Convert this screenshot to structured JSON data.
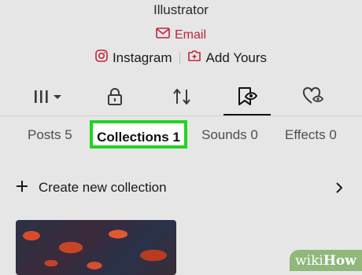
{
  "profile": {
    "bio": "Illustrator",
    "email_label": "Email",
    "links": [
      {
        "label": "Instagram",
        "icon": "instagram-icon"
      },
      {
        "label": "Add Yours",
        "icon": "add-yours-icon"
      }
    ]
  },
  "icon_tabs": [
    {
      "name": "grid-icon",
      "active": false
    },
    {
      "name": "lock-icon",
      "active": false
    },
    {
      "name": "repost-icon",
      "active": false
    },
    {
      "name": "bookmark-icon",
      "active": true
    },
    {
      "name": "liked-heart-icon",
      "active": false
    }
  ],
  "content_tabs": {
    "posts": "Posts 5",
    "collections": "Collections 1",
    "sounds": "Sounds 0",
    "effects": "Effects 0",
    "active": "collections"
  },
  "create_collection": {
    "label": "Create new collection"
  },
  "watermark": {
    "wiki": "wiki",
    "how": "How"
  },
  "colors": {
    "accent_red": "#c2233a",
    "highlight_green": "#20d420",
    "background": "#e6e6e6",
    "watermark_green": "#8fb87a"
  }
}
